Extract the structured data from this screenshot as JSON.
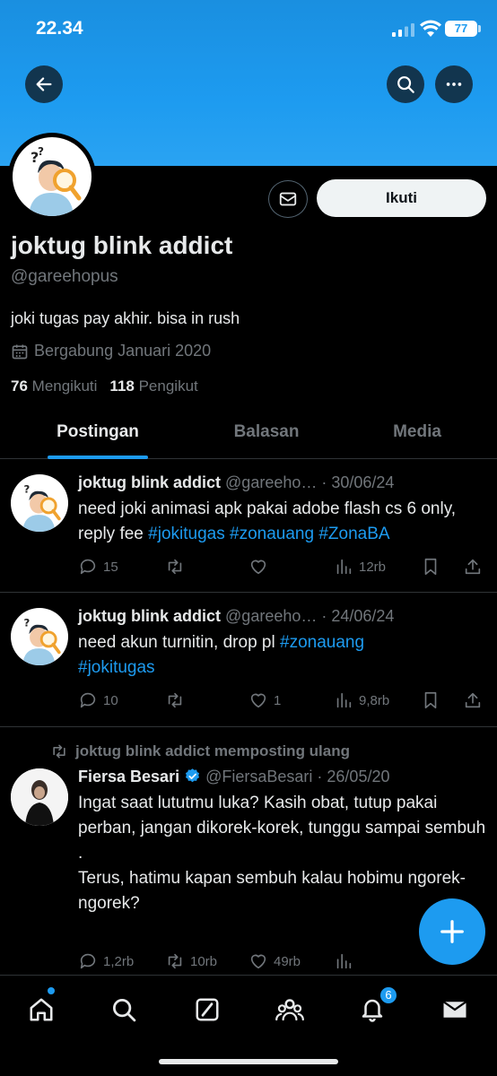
{
  "status_bar": {
    "time": "22.34",
    "battery": "77"
  },
  "profile": {
    "name": "joktug blink addict",
    "handle": "@gareehopus",
    "bio": "joki tugas pay akhir. bisa in rush",
    "joined": "Bergabung Januari 2020",
    "following_count": "76",
    "following_label": "Mengikuti",
    "followers_count": "118",
    "followers_label": "Pengikut",
    "follow_button": "Ikuti"
  },
  "tabs": [
    {
      "label": "Postingan",
      "active": true
    },
    {
      "label": "Balasan",
      "active": false
    },
    {
      "label": "Media",
      "active": false
    }
  ],
  "tweets": [
    {
      "name": "joktug blink addict",
      "handle_meta": "@gareeho… · 30/06/24",
      "text": "need joki animasi apk pakai adobe flash cs 6 only, reply fee",
      "tags": [
        "#jokitugas",
        "#zonauang",
        "#ZonaBA"
      ],
      "replies": "15",
      "retweets": "",
      "likes": "",
      "views": "12rb"
    },
    {
      "name": "joktug blink addict",
      "handle_meta": "@gareeho… · 24/06/24",
      "text": "need akun turnitin, drop pl",
      "tags": [
        "#zonauang",
        "#jokitugas"
      ],
      "replies": "10",
      "retweets": "",
      "likes": "1",
      "views": "9,8rb"
    },
    {
      "retweet_label": "joktug blink addict memposting ulang",
      "name": "Fiersa Besari",
      "handle_meta": "@FiersaBesari · 26/05/20",
      "text_lines": [
        "Ingat saat lututmu luka? Kasih obat, tutup pakai perban, jangan dikorek-korek, tunggu sampai sembuh",
        ".",
        "Terus, hatimu kapan sembuh kalau hobimu ngorek-ngorek?"
      ],
      "replies": "1,2rb",
      "retweets": "10rb",
      "likes": "49rb"
    }
  ],
  "nav": {
    "notification_count": "6"
  },
  "colors": {
    "accent": "#1d9bf0",
    "background": "#000000",
    "muted": "#71767b"
  }
}
